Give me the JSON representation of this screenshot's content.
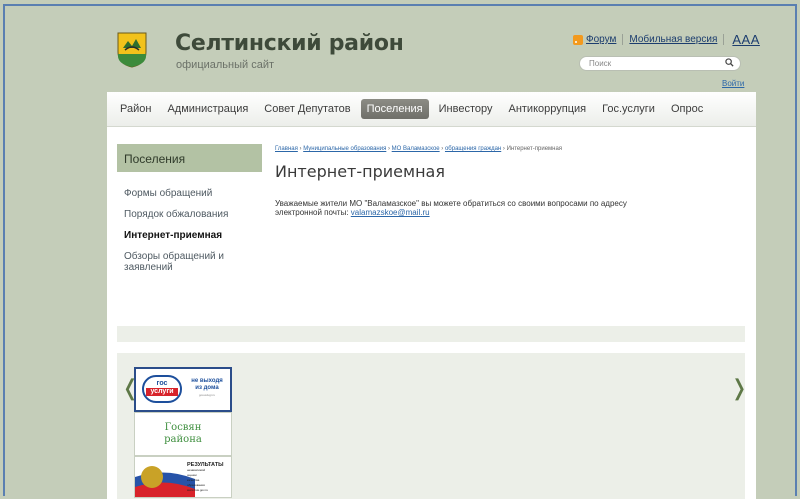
{
  "header": {
    "title": "Селтинский район",
    "subtitle": "официальный сайт",
    "forum_link": "Форум",
    "mobile_link": "Мобильная версия",
    "font_size_toggle": "AAA",
    "search_placeholder": "Поиск",
    "login_link": "Войти"
  },
  "nav": {
    "items": [
      "Район",
      "Администрация",
      "Совет Депутатов",
      "Поселения",
      "Инвестору",
      "Антикоррупция",
      "Гос.услуги",
      "Опрос"
    ],
    "active": "Поселения"
  },
  "sidebar": {
    "title": "Поселения",
    "items": [
      "Формы обращений",
      "Порядок обжалования",
      "Интернет-приемная",
      "Обзоры обращений и заявлений"
    ],
    "current": "Интернет-приемная"
  },
  "breadcrumb": {
    "items": [
      "Главная",
      "Муниципальные образования",
      "МО Валамазское",
      "обращения граждан"
    ],
    "current": "Интернет-приемная"
  },
  "content": {
    "title": "Интернет-приемная",
    "text": "Уважаемые жители МО \"Валамазское\" вы можете обратиться со своими вопросами по адресу электронной почты:",
    "email": "valamazskoe@mail.ru"
  },
  "carousel": {
    "prev": "❬",
    "next": "❭",
    "banner1": {
      "logo_line1": "гос",
      "logo_line2": "услуги",
      "text1": "не выходя",
      "text2": "из дома",
      "url": "gosuslugi.ru"
    },
    "banner2": {
      "line1": "Госвян",
      "line2": "района"
    },
    "banner3": {
      "heading": "РЕЗУЛЬТАТЫ",
      "lines": [
        "независимой",
        "оценки",
        "качества",
        "образования",
        "www.bus.gov.ru"
      ]
    }
  },
  "colors": {
    "background": "#c4cdb9",
    "sidebar_header": "#b3c2a4",
    "nav_active": "#7a7a74",
    "link": "#2c67a8",
    "frame": "#5a7fb1"
  }
}
